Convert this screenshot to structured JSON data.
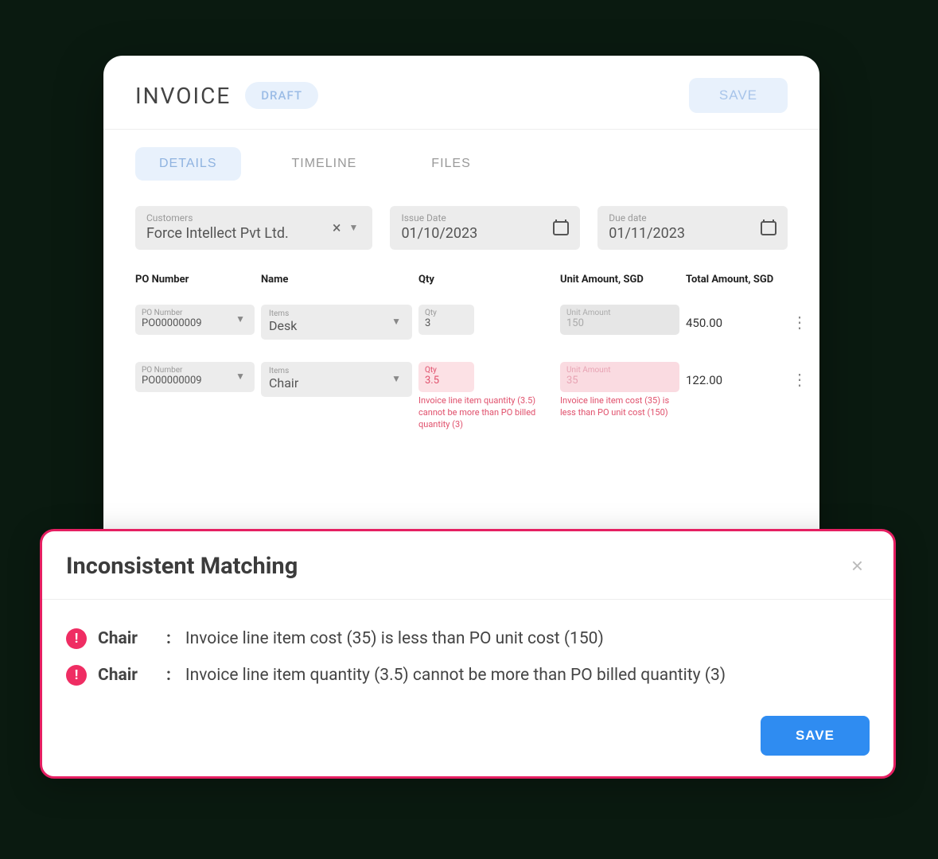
{
  "header": {
    "title": "INVOICE",
    "status": "DRAFT",
    "save": "SAVE"
  },
  "tabs": [
    {
      "label": "DETAILS",
      "active": true
    },
    {
      "label": "TIMELINE",
      "active": false
    },
    {
      "label": "FILES",
      "active": false
    }
  ],
  "fields": {
    "customer": {
      "label": "Customers",
      "value": "Force Intellect Pvt Ltd."
    },
    "issue_date": {
      "label": "Issue Date",
      "value": "01/10/2023"
    },
    "due_date": {
      "label": "Due date",
      "value": "01/11/2023"
    }
  },
  "table": {
    "columns": {
      "po": "PO Number",
      "name": "Name",
      "qty": "Qty",
      "unit": "Unit Amount, SGD",
      "total": "Total Amount, SGD"
    },
    "cell_labels": {
      "po": "PO Number",
      "item": "Items",
      "qty": "Qty",
      "unit": "Unit Amount"
    },
    "rows": [
      {
        "po": "PO00000009",
        "item": "Desk",
        "qty": "3",
        "qty_error": "",
        "unit": "150",
        "unit_error": "",
        "total": "450.00",
        "has_error": false
      },
      {
        "po": "PO00000009",
        "item": "Chair",
        "qty": "3.5",
        "qty_error": "Invoice line item quantity (3.5) cannot be more than PO billed quantity (3)",
        "unit": "35",
        "unit_error": "Invoice line item cost (35) is less than PO unit cost (150)",
        "total": "122.00",
        "has_error": true
      }
    ]
  },
  "dialog": {
    "title": "Inconsistent Matching",
    "issues": [
      {
        "item": "Chair",
        "msg": "Invoice line item cost (35) is less than PO unit cost (150)"
      },
      {
        "item": "Chair",
        "msg": "Invoice line item quantity (3.5) cannot be more than PO billed quantity (3)"
      }
    ],
    "save": "SAVE"
  }
}
